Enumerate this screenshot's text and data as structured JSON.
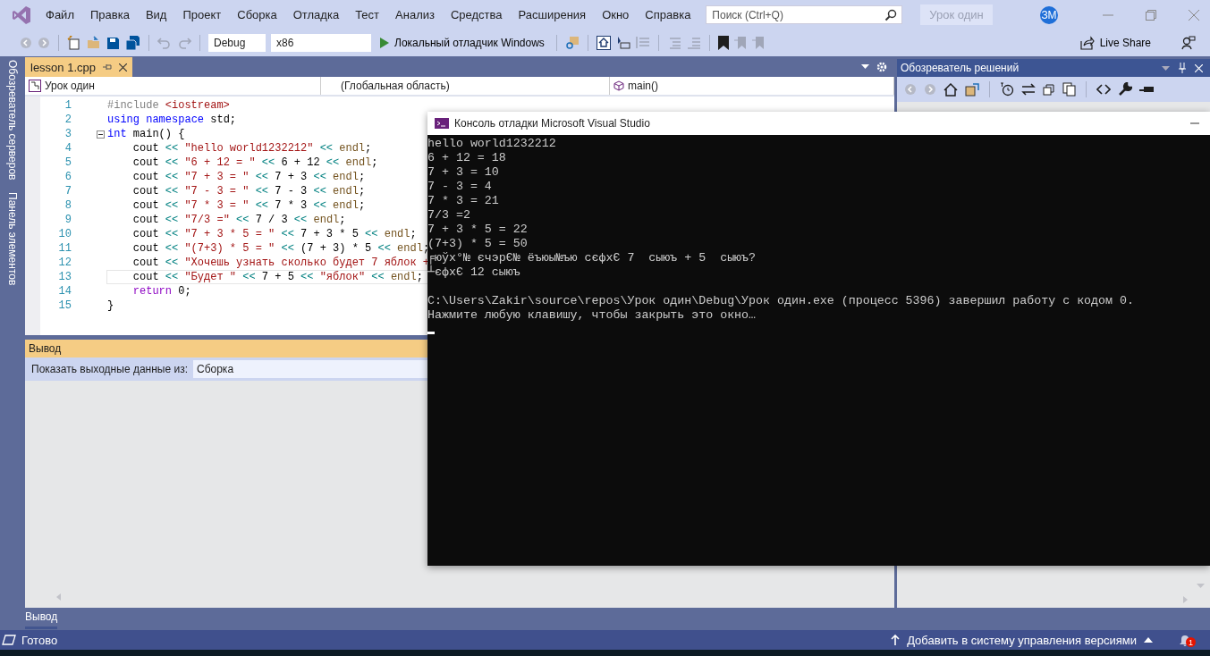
{
  "menu": [
    "Файл",
    "Правка",
    "Вид",
    "Проект",
    "Сборка",
    "Отладка",
    "Тест",
    "Анализ",
    "Средства",
    "Расширения",
    "Окно",
    "Справка"
  ],
  "search": {
    "placeholder": "Поиск (Ctrl+Q)"
  },
  "project_title": "Урок один",
  "avatar": "ЗМ",
  "toolbar": {
    "configuration": "Debug",
    "platform": "x86",
    "run": "Локальный отладчик Windows",
    "live_share": "Live Share"
  },
  "side_tabs": [
    "Обозреватель серверов",
    "Панель элементов"
  ],
  "document_tabs": [
    {
      "label": "lesson 1.cpp",
      "selected": true
    }
  ],
  "nav_bar": [
    "Урок один",
    "(Глобальная область)",
    "main()"
  ],
  "code": [
    {
      "number": "1",
      "current": false,
      "tokens": [
        {
          "text": "#include ",
          "kind": "pp"
        },
        {
          "text": "<iostream>",
          "kind": "str"
        }
      ]
    },
    {
      "number": "2",
      "current": false,
      "tokens": [
        {
          "text": "using ",
          "kind": "kw"
        },
        {
          "text": "namespace ",
          "kind": "kw"
        },
        {
          "text": "std;",
          "kind": "pl"
        }
      ]
    },
    {
      "number": "3",
      "current": false,
      "expanded": true,
      "tokens": [
        {
          "text": "int ",
          "kind": "kw"
        },
        {
          "text": "main() {",
          "kind": "pl"
        }
      ],
      "children": [
        {
          "number": "4",
          "current": false,
          "tokens": [
            {
              "text": "cout",
              "kind": "pl"
            },
            {
              "text": " << ",
              "kind": "op"
            },
            {
              "text": "\"hello world1232212\"",
              "kind": "str"
            },
            {
              "text": " << ",
              "kind": "op"
            },
            {
              "text": "endl",
              "kind": "fn"
            },
            {
              "text": ";",
              "kind": "pl"
            }
          ]
        },
        {
          "number": "5",
          "current": false,
          "tokens": [
            {
              "text": "cout",
              "kind": "pl"
            },
            {
              "text": " << ",
              "kind": "op"
            },
            {
              "text": "\"6 + 12 = \"",
              "kind": "str"
            },
            {
              "text": " << ",
              "kind": "op"
            },
            {
              "text": "6 + 12",
              "kind": "pl"
            },
            {
              "text": " << ",
              "kind": "op"
            },
            {
              "text": "endl",
              "kind": "fn"
            },
            {
              "text": ";",
              "kind": "pl"
            }
          ]
        },
        {
          "number": "6",
          "current": false,
          "tokens": [
            {
              "text": "cout",
              "kind": "pl"
            },
            {
              "text": " << ",
              "kind": "op"
            },
            {
              "text": "\"7 + 3 = \"",
              "kind": "str"
            },
            {
              "text": " << ",
              "kind": "op"
            },
            {
              "text": "7 + 3",
              "kind": "pl"
            },
            {
              "text": " << ",
              "kind": "op"
            },
            {
              "text": "endl",
              "kind": "fn"
            },
            {
              "text": ";",
              "kind": "pl"
            }
          ]
        },
        {
          "number": "7",
          "current": false,
          "tokens": [
            {
              "text": "cout",
              "kind": "pl"
            },
            {
              "text": " << ",
              "kind": "op"
            },
            {
              "text": "\"7 - 3 = \"",
              "kind": "str"
            },
            {
              "text": " << ",
              "kind": "op"
            },
            {
              "text": "7 - 3",
              "kind": "pl"
            },
            {
              "text": " << ",
              "kind": "op"
            },
            {
              "text": "endl",
              "kind": "fn"
            },
            {
              "text": ";",
              "kind": "pl"
            }
          ]
        },
        {
          "number": "8",
          "current": false,
          "tokens": [
            {
              "text": "cout",
              "kind": "pl"
            },
            {
              "text": " << ",
              "kind": "op"
            },
            {
              "text": "\"7 * 3 = \"",
              "kind": "str"
            },
            {
              "text": " << ",
              "kind": "op"
            },
            {
              "text": "7 * 3",
              "kind": "pl"
            },
            {
              "text": " << ",
              "kind": "op"
            },
            {
              "text": "endl",
              "kind": "fn"
            },
            {
              "text": ";",
              "kind": "pl"
            }
          ]
        },
        {
          "number": "9",
          "current": false,
          "tokens": [
            {
              "text": "cout",
              "kind": "pl"
            },
            {
              "text": " << ",
              "kind": "op"
            },
            {
              "text": "\"7/3 =\"",
              "kind": "str"
            },
            {
              "text": " << ",
              "kind": "op"
            },
            {
              "text": "7 / 3",
              "kind": "pl"
            },
            {
              "text": " << ",
              "kind": "op"
            },
            {
              "text": "endl",
              "kind": "fn"
            },
            {
              "text": ";",
              "kind": "pl"
            }
          ]
        },
        {
          "number": "10",
          "current": false,
          "tokens": [
            {
              "text": "cout",
              "kind": "pl"
            },
            {
              "text": " << ",
              "kind": "op"
            },
            {
              "text": "\"7 + 3 * 5 = \"",
              "kind": "str"
            },
            {
              "text": " << ",
              "kind": "op"
            },
            {
              "text": "7 + 3 * 5",
              "kind": "pl"
            },
            {
              "text": " << ",
              "kind": "op"
            },
            {
              "text": "endl",
              "kind": "fn"
            },
            {
              "text": ";",
              "kind": "pl"
            }
          ]
        },
        {
          "number": "11",
          "current": false,
          "tokens": [
            {
              "text": "cout",
              "kind": "pl"
            },
            {
              "text": " << ",
              "kind": "op"
            },
            {
              "text": "\"(7+3) * 5 = \"",
              "kind": "str"
            },
            {
              "text": " << ",
              "kind": "op"
            },
            {
              "text": "(7 + 3) * 5",
              "kind": "pl"
            },
            {
              "text": " << ",
              "kind": "op"
            },
            {
              "text": "endl",
              "kind": "fn"
            },
            {
              "text": ";",
              "kind": "pl"
            }
          ]
        },
        {
          "number": "12",
          "current": false,
          "tokens": [
            {
              "text": "cout",
              "kind": "pl"
            },
            {
              "text": " << ",
              "kind": "op"
            },
            {
              "text": "\"Хочешь узнать сколько будет 7 яблок +",
              "kind": "str"
            }
          ]
        },
        {
          "number": "13",
          "current": true,
          "tokens": [
            {
              "text": "cout",
              "kind": "pl"
            },
            {
              "text": " << ",
              "kind": "op"
            },
            {
              "text": "\"Будет \"",
              "kind": "str"
            },
            {
              "text": " << ",
              "kind": "op"
            },
            {
              "text": "7 + 5",
              "kind": "pl"
            },
            {
              "text": " << ",
              "kind": "op"
            },
            {
              "text": "\"яблок\"",
              "kind": "str"
            },
            {
              "text": " << ",
              "kind": "op"
            },
            {
              "text": "endl",
              "kind": "fn"
            },
            {
              "text": ";",
              "kind": "pl"
            }
          ]
        },
        {
          "number": "14",
          "current": false,
          "tokens": [
            {
              "text": "return ",
              "kind": "ret"
            },
            {
              "text": "0;",
              "kind": "pl"
            }
          ]
        }
      ]
    },
    {
      "number": "15",
      "current": false,
      "tokens": [
        {
          "text": "}",
          "kind": "pl"
        }
      ]
    }
  ],
  "output": {
    "title": "Вывод",
    "label": "Показать выходные данные из:",
    "source": "Сборка"
  },
  "bottom_tabs": [
    {
      "label": "Вывод",
      "selected": true
    }
  ],
  "solution_explorer": {
    "title": "Обозреватель решений"
  },
  "console": {
    "title": "Консоль отладки Microsoft Visual Studio",
    "lines": [
      "hello world1232212",
      "6 + 12 = 18",
      "7 + 3 = 10",
      "7 - 3 = 4",
      "7 * 3 = 21",
      "7/3 =2",
      "7 + 3 * 5 = 22",
      "(7+3) * 5 = 50",
      "╒юўх°№ єчэрЄ№ ёъюы№ъю сєфхЄ 7  сыюъ + 5  сыюъ?",
      "┴єфхЄ 12 сыюъ"
    ],
    "exit_message": [
      "C:\\Users\\Zakir\\source\\repos\\Урок один\\Debug\\Урок один.exe (процесс 5396) завершил работу с кодом 0.",
      "Нажмите любую клавишу, чтобы закрыть это окно…"
    ]
  },
  "status_bar": {
    "text": "Готово",
    "source_control": "Добавить в систему управления версиями",
    "notifications": "1"
  }
}
